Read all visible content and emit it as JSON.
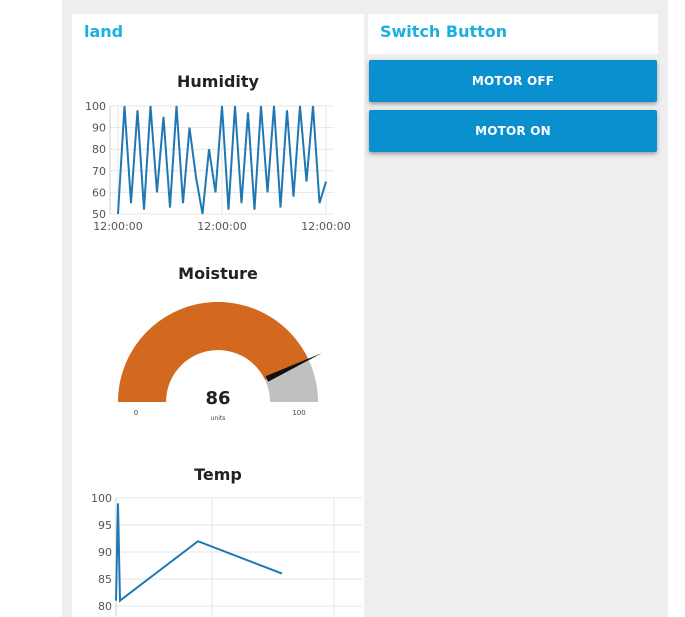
{
  "groups": {
    "land": {
      "title": "land",
      "humidity": {
        "title": "Humidity",
        "y_ticks": [
          "100",
          "90",
          "80",
          "70",
          "60",
          "50"
        ],
        "x_ticks": [
          "12:00:00",
          "12:00:00",
          "12:00:00"
        ]
      },
      "moisture": {
        "title": "Moisture",
        "value": "86",
        "units": "units",
        "min_label": "0",
        "max_label": "100"
      },
      "temp": {
        "title": "Temp",
        "y_ticks": [
          "100",
          "95",
          "90",
          "85",
          "80"
        ]
      }
    },
    "switch": {
      "title": "Switch Button",
      "motor_off_label": "MOTOR OFF",
      "motor_on_label": "MOTOR ON"
    }
  },
  "colors": {
    "accent_title": "#1bb0e0",
    "line": "#1f77b4",
    "gauge_fill": "#d2691e",
    "gauge_bg": "#c0c0c0",
    "button": "#0a8fcf"
  },
  "chart_data": [
    {
      "type": "line",
      "title": "Humidity",
      "ylim": [
        50,
        100
      ],
      "y": [
        50,
        100,
        55,
        98,
        52,
        100,
        60,
        95,
        53,
        100,
        55,
        90,
        67,
        50,
        80,
        60,
        100,
        52,
        100,
        55,
        97,
        52,
        100,
        60,
        100,
        53,
        98,
        58,
        100,
        65,
        100,
        55,
        65
      ]
    },
    {
      "type": "gauge",
      "title": "Moisture",
      "value": 86,
      "min": 0,
      "max": 100,
      "units": "units"
    },
    {
      "type": "line",
      "title": "Temp",
      "ylim": [
        80,
        100
      ],
      "y": [
        81,
        99,
        81,
        92,
        86
      ]
    }
  ]
}
